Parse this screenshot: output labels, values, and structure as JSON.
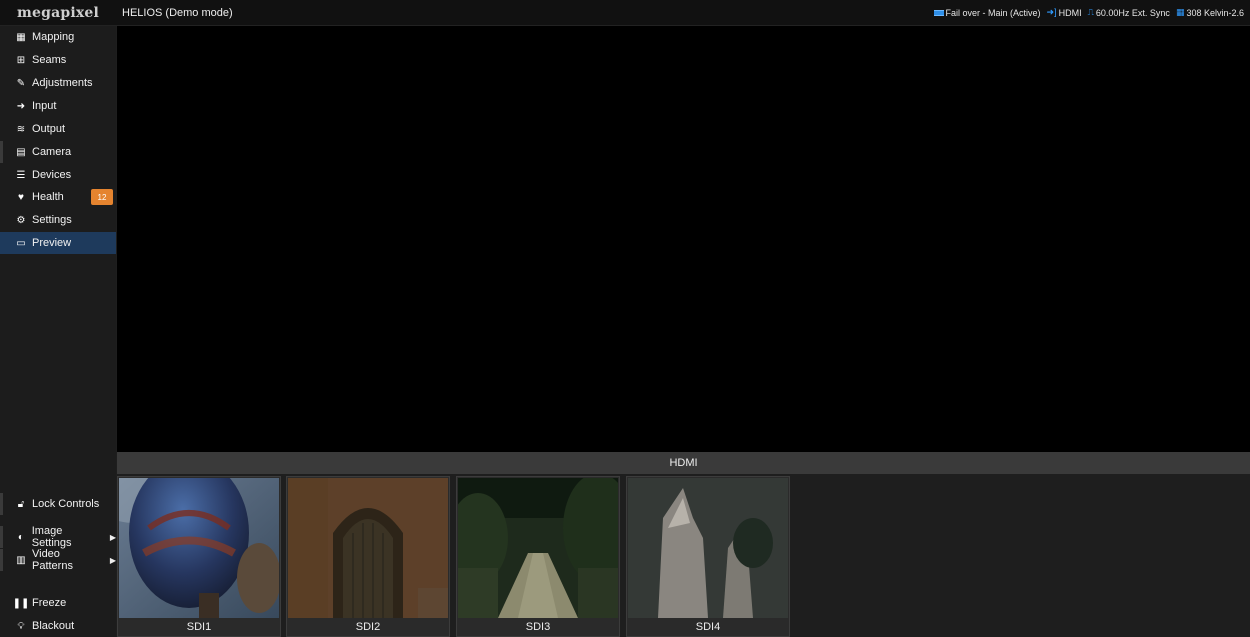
{
  "brand": {
    "logo": "megapixel"
  },
  "header": {
    "title": "HELIOS (Demo mode)",
    "status": {
      "failover": "Fail over - Main (Active)",
      "input": "HDMI",
      "sync": "60.00Hz Ext. Sync",
      "temperature": "308 Kelvin-2.6"
    }
  },
  "sidebar": {
    "items": [
      {
        "label": "Mapping",
        "icon": "grid-icon"
      },
      {
        "label": "Seams",
        "icon": "plus-square-icon"
      },
      {
        "label": "Adjustments",
        "icon": "brush-icon"
      },
      {
        "label": "Input",
        "icon": "sign-in-icon"
      },
      {
        "label": "Output",
        "icon": "sliders-icon"
      },
      {
        "label": "Camera",
        "icon": "film-icon"
      },
      {
        "label": "Devices",
        "icon": "list-icon"
      },
      {
        "label": "Health",
        "icon": "heartbeat-icon",
        "badge": "12"
      },
      {
        "label": "Settings",
        "icon": "gears-icon"
      },
      {
        "label": "Preview",
        "icon": "monitor-icon",
        "active": true
      }
    ],
    "bottom": {
      "lock": "Lock Controls",
      "image_settings": "Image Settings",
      "video_patterns": "Video Patterns",
      "freeze": "Freeze",
      "blackout": "Blackout"
    }
  },
  "preview": {
    "source_label": "HDMI"
  },
  "thumbnails": [
    {
      "label": "SDI1"
    },
    {
      "label": "SDI2"
    },
    {
      "label": "SDI3"
    },
    {
      "label": "SDI4"
    }
  ],
  "colors": {
    "accent": "#1e3a5c",
    "badge": "#e5842f",
    "status_icon": "#2f9bff"
  }
}
